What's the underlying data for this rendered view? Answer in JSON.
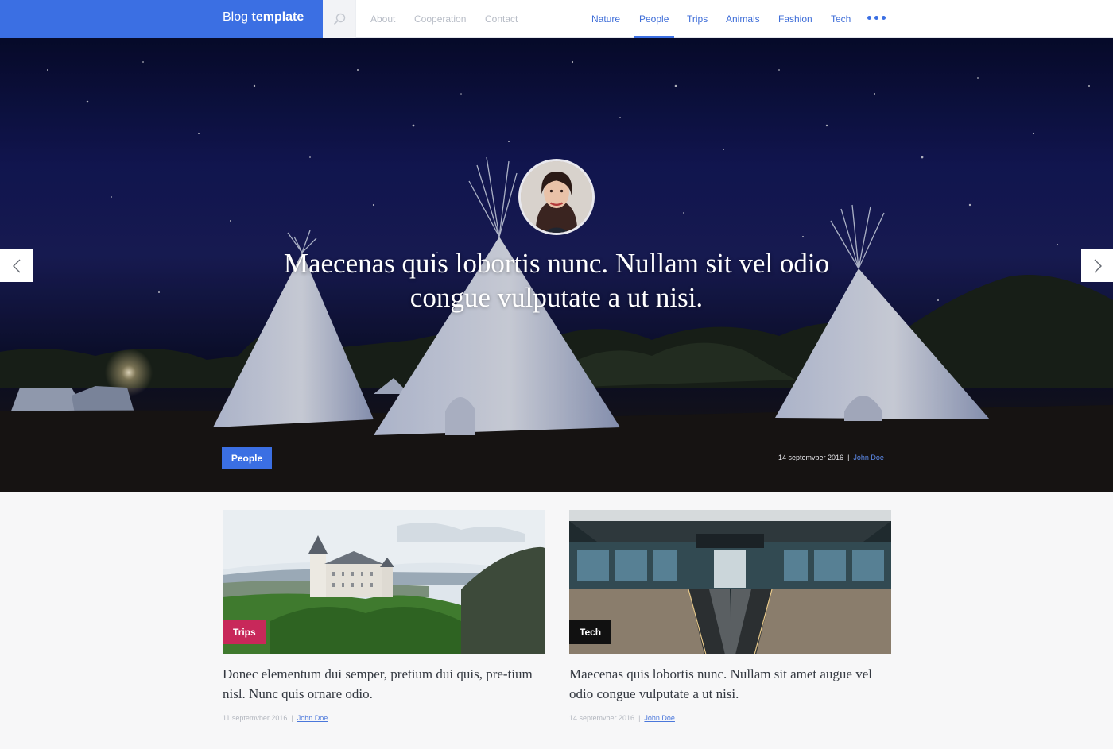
{
  "header": {
    "brand_light": "Blog",
    "brand_bold": "template",
    "links": [
      "About",
      "Cooperation",
      "Contact"
    ],
    "categories": [
      "Nature",
      "People",
      "Trips",
      "Animals",
      "Fashion",
      "Tech"
    ],
    "active_category": "People",
    "accent": "#3b6fe3"
  },
  "hero": {
    "title": "Maecenas quis lobortis nunc. Nullam sit vel odio congue vulputate a ut nisi.",
    "tag": "People",
    "date": "14 septemvber 2016",
    "separator": "|",
    "author": "John Doe",
    "tag_color": "#3b6fe3"
  },
  "posts": [
    {
      "tag": "Trips",
      "tag_color": "#c8285a",
      "title": "Donec elementum dui semper, pretium dui quis, pre-tium nisl. Nunc quis ornare odio.",
      "date": "11 septemvber 2016",
      "separator": "|",
      "author": "John Doe"
    },
    {
      "tag": "Tech",
      "tag_color": "#111111",
      "title": "Maecenas quis lobortis nunc. Nullam sit amet augue vel odio congue vulputate a ut nisi.",
      "date": "14 septemvber 2016",
      "separator": "|",
      "author": "John Doe"
    }
  ],
  "icons": {
    "search": "search-icon",
    "more": "more-dots-icon",
    "prev": "chevron-left-icon",
    "next": "chevron-right-icon"
  }
}
